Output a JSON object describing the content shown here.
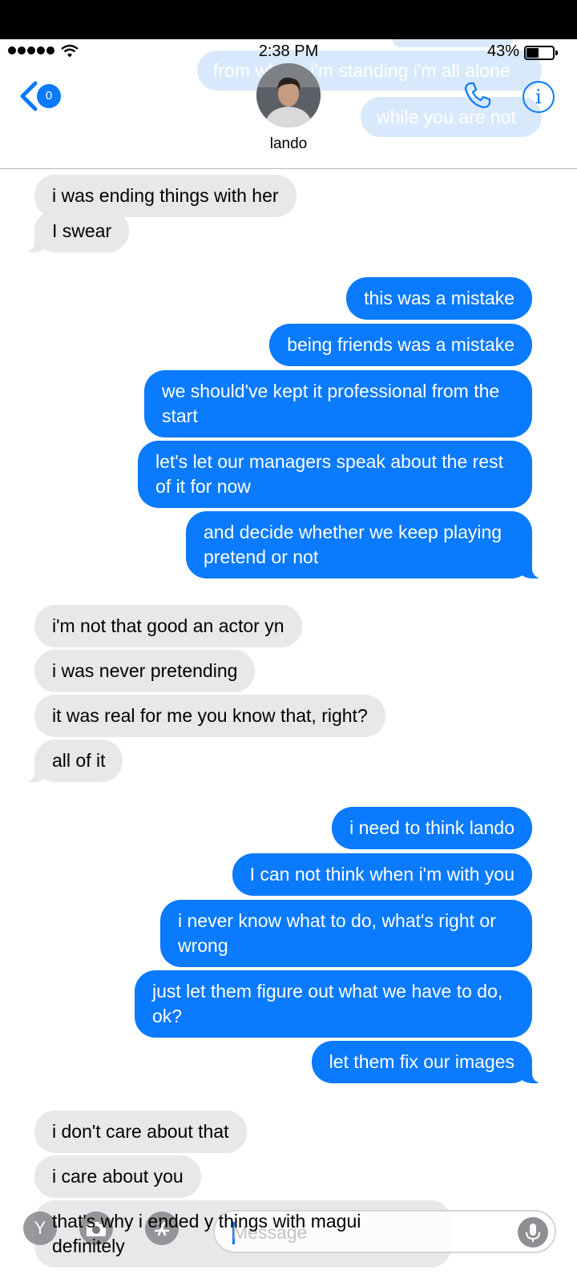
{
  "status_bar": {
    "time": "2:38 PM",
    "battery_percent": "43%",
    "battery_level": 0.43,
    "signal_bars": 5
  },
  "header": {
    "back_badge": "0",
    "contact_name": "lando",
    "ghost_messages": [
      "from where i'm standing i'm all alone",
      "while you are not"
    ]
  },
  "messages": [
    {
      "side": "received",
      "text": "i was ending things with her"
    },
    {
      "side": "received",
      "text": "I swear"
    },
    {
      "side": "sent",
      "text": "this was a mistake"
    },
    {
      "side": "sent",
      "text": "being friends was a mistake"
    },
    {
      "side": "sent",
      "text": "we should've kept it professional from the start"
    },
    {
      "side": "sent",
      "text": "let's let our managers speak about the rest of it for now"
    },
    {
      "side": "sent",
      "text": "and decide whether we keep playing pretend or not"
    },
    {
      "side": "received",
      "text": "i'm not that good an actor yn"
    },
    {
      "side": "received",
      "text": "i was never pretending"
    },
    {
      "side": "received",
      "text": "it was real for me you know that, right?"
    },
    {
      "side": "received",
      "text": "all of it"
    },
    {
      "side": "sent",
      "text": "i need to think lando"
    },
    {
      "side": "sent",
      "text": "I can not think when i'm with you"
    },
    {
      "side": "sent",
      "text": "i never know what to do, what's right or wrong"
    },
    {
      "side": "sent",
      "text": "just let them figure out what we have to do, ok?"
    },
    {
      "side": "sent",
      "text": "let them fix our images"
    },
    {
      "side": "received",
      "text": "i don't care about that"
    },
    {
      "side": "received",
      "text": "i care about you"
    },
    {
      "side": "received",
      "text": "that's why i ended y things with magui definitely"
    }
  ],
  "composer": {
    "placeholder": "Message",
    "value": "",
    "yahoo_label": "Y"
  },
  "colors": {
    "sent_bubble": "#0a7aff",
    "received_bubble": "#e8e8eb",
    "accent": "#0a7aff"
  }
}
